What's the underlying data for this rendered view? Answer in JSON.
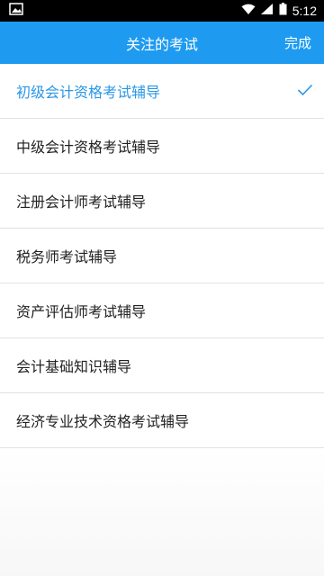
{
  "status_bar": {
    "time": "5:12",
    "icons": [
      "image-icon",
      "wifi-icon",
      "signal-icon",
      "battery-icon"
    ]
  },
  "header": {
    "title": "关注的考试",
    "done_label": "完成",
    "background": "#1e9bf0"
  },
  "exams": [
    {
      "label": "初级会计资格考试辅导",
      "selected": true
    },
    {
      "label": "中级会计资格考试辅导",
      "selected": false
    },
    {
      "label": "注册会计师考试辅导",
      "selected": false
    },
    {
      "label": "税务师考试辅导",
      "selected": false
    },
    {
      "label": "资产评估师考试辅导",
      "selected": false
    },
    {
      "label": "会计基础知识辅导",
      "selected": false
    },
    {
      "label": "经济专业技术资格考试辅导",
      "selected": false
    }
  ],
  "colors": {
    "accent": "#2a97e6",
    "divider": "#e2e2e2"
  }
}
